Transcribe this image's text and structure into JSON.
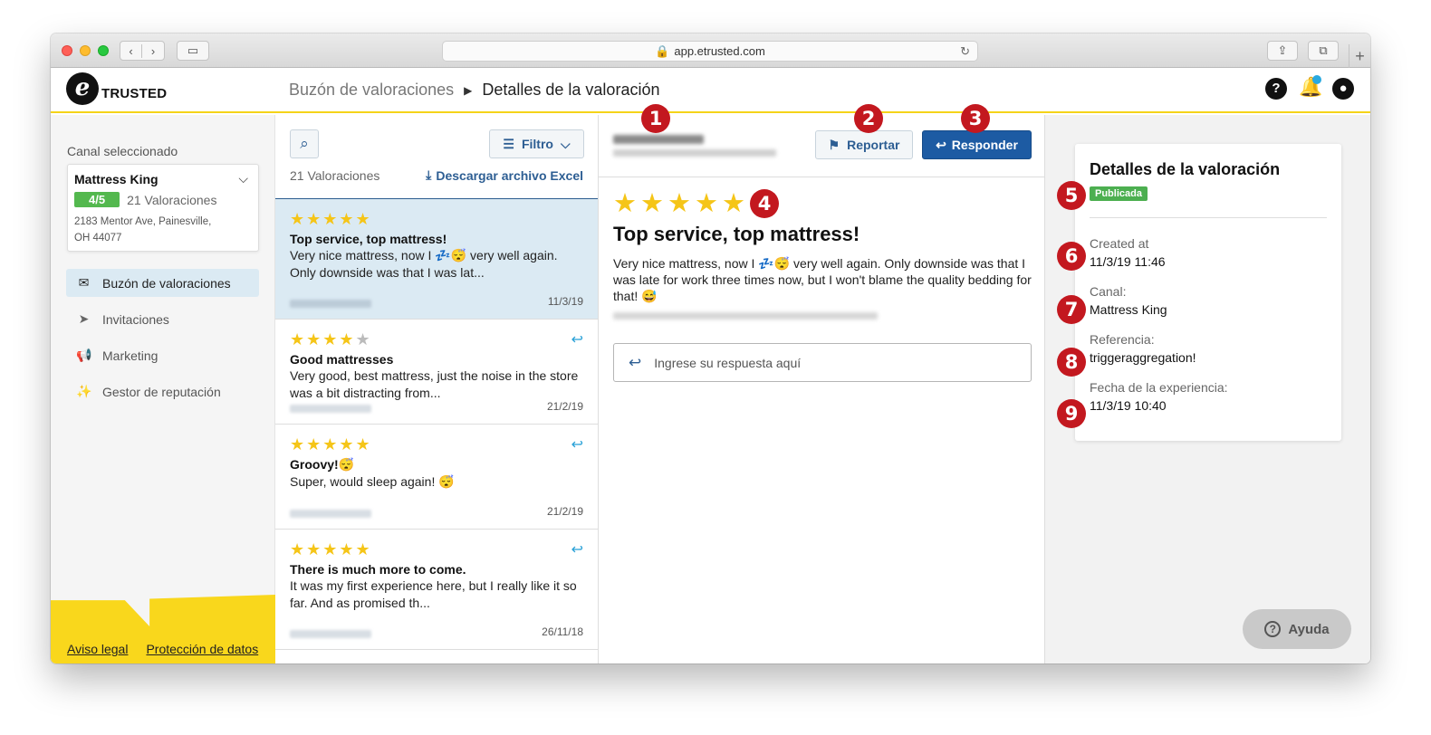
{
  "browser": {
    "url": "app.etrusted.com"
  },
  "header": {
    "logo_text": "TRUSTED",
    "breadcrumb_root": "Buzón de valoraciones",
    "breadcrumb_current": "Detalles de la valoración",
    "icons": [
      "help-icon",
      "bell-icon",
      "account-icon"
    ]
  },
  "sidebar": {
    "channel_label": "Canal seleccionado",
    "channel": {
      "name": "Mattress King",
      "score": "4/5",
      "count": "21 Valoraciones",
      "address_line1": "2183 Mentor Ave, Painesville,",
      "address_line2": "OH 44077"
    },
    "items": [
      {
        "label": "Buzón de valoraciones",
        "icon": "inbox-icon",
        "active": true
      },
      {
        "label": "Invitaciones",
        "icon": "paper-plane-icon",
        "active": false
      },
      {
        "label": "Marketing",
        "icon": "megaphone-icon",
        "active": false
      },
      {
        "label": "Gestor de reputación",
        "icon": "sparkles-icon",
        "active": false
      }
    ],
    "legal": "Aviso legal",
    "privacy": "Protección de datos"
  },
  "list": {
    "filter_label": "Filtro",
    "count_label": "21 Valoraciones",
    "excel_label": "Descargar archivo Excel",
    "reviews": [
      {
        "rating": 5,
        "title": "Top service, top mattress!",
        "text": "Very nice mattress, now I 💤😴 very well again. Only downside was that I was lat...",
        "date": "11/3/19",
        "replied": false
      },
      {
        "rating": 4,
        "title": "Good mattresses",
        "text": "Very good, best mattress, just the noise in the store was a bit distracting from...",
        "date": "21/2/19",
        "replied": true
      },
      {
        "rating": 5,
        "title": "Groovy!😴",
        "text": "Super, would sleep again! 😴",
        "date": "21/2/19",
        "replied": true
      },
      {
        "rating": 5,
        "title": "There is much more to come.",
        "text": "It was my first experience here, but I really like it so far. And as promised th...",
        "date": "26/11/18",
        "replied": true
      }
    ]
  },
  "detail": {
    "report_label": "Reportar",
    "respond_label": "Responder",
    "rating": 5,
    "title": "Top service, top mattress!",
    "text": "Very nice mattress, now I 💤😴 very well again. Only downside was that I was late for work three times now, but I won't blame the quality bedding for that! 😅",
    "reply_placeholder": "Ingrese su respuesta aquí"
  },
  "info": {
    "title": "Detalles de la valoración",
    "status": "Publicada",
    "created_label": "Created at",
    "created_value": "11/3/19 11:46",
    "channel_label": "Canal:",
    "channel_value": "Mattress King",
    "reference_label": "Referencia:",
    "reference_value": "triggeraggregation!",
    "experience_label": "Fecha de la experiencia:",
    "experience_value": "11/3/19 10:40",
    "help_label": "Ayuda"
  },
  "markers": [
    "1",
    "2",
    "3",
    "4",
    "5",
    "6",
    "7",
    "8",
    "9"
  ],
  "colors": {
    "brand_yellow": "#f9d71c",
    "primary_blue": "#1d5ba3",
    "marker_red": "#c3181f",
    "star_gold": "#f5c518",
    "published_green": "#4caf50"
  }
}
